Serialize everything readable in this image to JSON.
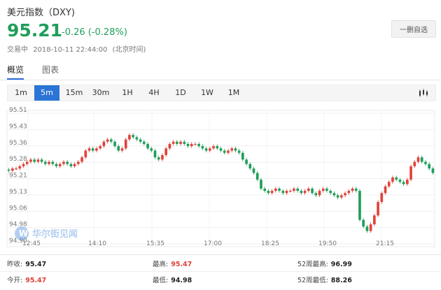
{
  "header": {
    "title": "美元指数（DXY)",
    "price": "95.21",
    "change": "-0.26 (-0.28%)",
    "status": "交易中",
    "datetime": "2018-10-11 22:44:00",
    "timezone": "(北京时间)",
    "remove_button": "一删自选"
  },
  "tabs": [
    {
      "label": "概览",
      "active": true
    },
    {
      "label": "图表",
      "active": false
    }
  ],
  "periods": [
    {
      "label": "1m"
    },
    {
      "label": "5m",
      "active": true
    },
    {
      "label": "15m"
    },
    {
      "label": "30m"
    },
    {
      "label": "1H"
    },
    {
      "label": "4H"
    },
    {
      "label": "1D"
    },
    {
      "label": "1W"
    },
    {
      "label": "1M"
    }
  ],
  "watermark": "华尔街见闻",
  "colors": {
    "up": "#e0423a",
    "down": "#1f9e5a",
    "accent": "#2a75d6"
  },
  "chart_data": {
    "type": "candlestick",
    "y_ticks": [
      "95.51",
      "95.43",
      "95.36",
      "95.28",
      "95.21",
      "95.13",
      "95.06",
      "94.98",
      "94.90"
    ],
    "x_ticks": [
      "12:45",
      "14:10",
      "15:35",
      "17:00",
      "18:25",
      "19:50",
      "21:15"
    ],
    "ylim": [
      94.9,
      95.51
    ],
    "grid": true,
    "closes": [
      95.24,
      95.25,
      95.25,
      95.26,
      95.27,
      95.28,
      95.29,
      95.28,
      95.29,
      95.28,
      95.27,
      95.28,
      95.27,
      95.26,
      95.27,
      95.28,
      95.27,
      95.26,
      95.27,
      95.28,
      95.3,
      95.33,
      95.34,
      95.33,
      95.34,
      95.35,
      95.37,
      95.38,
      95.37,
      95.35,
      95.33,
      95.34,
      95.38,
      95.4,
      95.39,
      95.38,
      95.37,
      95.36,
      95.34,
      95.33,
      95.3,
      95.29,
      95.31,
      95.34,
      95.36,
      95.37,
      95.36,
      95.37,
      95.36,
      95.35,
      95.36,
      95.36,
      95.35,
      95.34,
      95.33,
      95.34,
      95.35,
      95.34,
      95.33,
      95.32,
      95.33,
      95.34,
      95.33,
      95.32,
      95.29,
      95.27,
      95.25,
      95.23,
      95.2,
      95.16,
      95.15,
      95.14,
      95.15,
      95.16,
      95.15,
      95.14,
      95.15,
      95.15,
      95.16,
      95.15,
      95.14,
      95.15,
      95.16,
      95.14,
      95.13,
      95.15,
      95.16,
      95.15,
      95.14,
      95.13,
      95.12,
      95.13,
      95.14,
      95.15,
      95.16,
      95.15,
      95.02,
      94.99,
      94.97,
      95.0,
      95.04,
      95.1,
      95.14,
      95.17,
      95.19,
      95.21,
      95.2,
      95.19,
      95.18,
      95.2,
      95.26,
      95.28,
      95.3,
      95.28,
      95.27,
      95.25,
      95.23
    ],
    "change": "-0.26 (-0.28%)"
  },
  "stats": [
    {
      "label": "昨收:",
      "value": "95.47",
      "color": "dark"
    },
    {
      "label": "最高:",
      "value": "95.47",
      "color": "red"
    },
    {
      "label": "52周最高:",
      "value": "96.99",
      "color": "dark"
    },
    {
      "label": "今开:",
      "value": "95.47",
      "color": "red"
    },
    {
      "label": "最低:",
      "value": "94.98",
      "color": "dark"
    },
    {
      "label": "52周最低:",
      "value": "88.26",
      "color": "dark"
    }
  ]
}
